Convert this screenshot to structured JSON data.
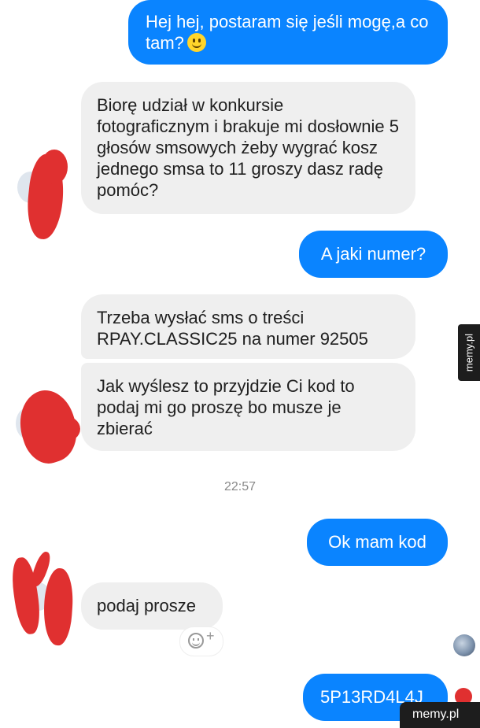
{
  "messages": [
    {
      "side": "out",
      "text": "Hej hej, postaram się jeśli mogę,a co tam?",
      "emoji": "smiling-face-emoji"
    },
    {
      "side": "in",
      "text": "Biorę udział w konkursie fotograficznym i brakuje mi dosłownie 5 głosów smsowych żeby wygrać kosz jednego smsa to 11 groszy dasz radę pomóc?"
    },
    {
      "side": "out",
      "text": "A jaki numer?"
    },
    {
      "side": "in",
      "text": "Trzeba wysłać sms o treści RPAY.CLASSIC25 na numer 92505"
    },
    {
      "side": "in",
      "text": "Jak wyślesz to przyjdzie Ci kod to podaj mi go proszę bo musze je zbierać"
    },
    {
      "side": "out",
      "text": "Ok mam kod"
    },
    {
      "side": "in",
      "text": "podaj prosze"
    },
    {
      "side": "out",
      "text": "5P13RD4L4J"
    }
  ],
  "timestamp": "22:57",
  "reaction_plus": "+",
  "watermark": "memy.pl",
  "colors": {
    "outgoing": "#0a84ff",
    "incoming": "#efefef",
    "redaction": "#e03030"
  }
}
